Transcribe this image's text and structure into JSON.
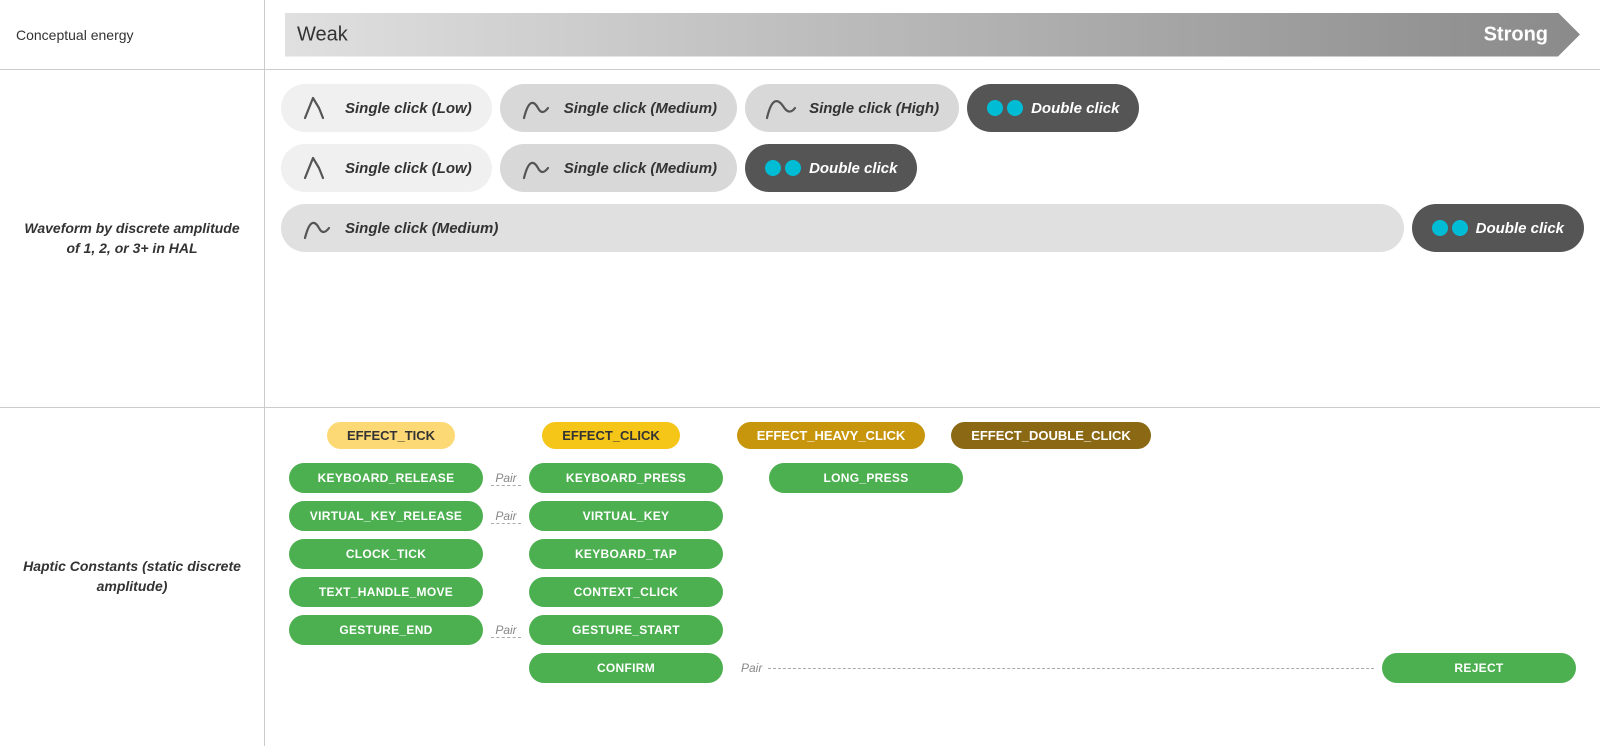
{
  "header": {
    "label": "Conceptual energy",
    "weak": "Weak",
    "strong": "Strong"
  },
  "waveform_section": {
    "label": "Waveform by discrete amplitude of 1, 2, or 3+ in HAL",
    "row1": {
      "pill1": {
        "text": "Single click (Low)",
        "type": "low"
      },
      "pill2": {
        "text": "Single click (Medium)",
        "type": "medium"
      },
      "pill3": {
        "text": "Single click (High)",
        "type": "high"
      },
      "pill4": {
        "text": "Double click",
        "type": "double"
      }
    },
    "row2": {
      "pill1": {
        "text": "Single click (Low)",
        "type": "low"
      },
      "pill2": {
        "text": "Single click (Medium)",
        "type": "medium"
      },
      "pill3": {
        "text": "Double click",
        "type": "double"
      }
    },
    "row3": {
      "pill1": {
        "text": "Single click (Medium)",
        "type": "medium"
      },
      "pill2": {
        "text": "Double click",
        "type": "double"
      }
    }
  },
  "haptic_section": {
    "label": "Haptic Constants (static discrete amplitude)",
    "effects": [
      {
        "id": "effect-tick",
        "text": "EFFECT_TICK",
        "style": "light"
      },
      {
        "id": "effect-click",
        "text": "EFFECT_CLICK",
        "style": "medium"
      },
      {
        "id": "effect-heavy-click",
        "text": "EFFECT_HEAVY_CLICK",
        "style": "dark"
      },
      {
        "id": "effect-double-click",
        "text": "EFFECT_DOUBLE_CLICK",
        "style": "darkest"
      }
    ],
    "constants": {
      "col1": [
        "KEYBOARD_RELEASE",
        "VIRTUAL_KEY_RELEASE",
        "CLOCK_TICK",
        "TEXT_HANDLE_MOVE",
        "GESTURE_END"
      ],
      "col2": [
        "KEYBOARD_PRESS",
        "VIRTUAL_KEY",
        "KEYBOARD_TAP",
        "CONTEXT_CLICK",
        "GESTURE_START",
        "CONFIRM"
      ],
      "col3": [
        "LONG_PRESS"
      ],
      "col4": [
        "REJECT"
      ]
    },
    "pairs": [
      {
        "from": "KEYBOARD_RELEASE",
        "to": "KEYBOARD_PRESS",
        "label": "Pair"
      },
      {
        "from": "VIRTUAL_KEY_RELEASE",
        "to": "VIRTUAL_KEY",
        "label": "Pair"
      },
      {
        "from": "GESTURE_END",
        "to": "GESTURE_START",
        "label": "Pair"
      },
      {
        "from": "CONFIRM",
        "to": "REJECT",
        "label": "Pair"
      }
    ]
  }
}
